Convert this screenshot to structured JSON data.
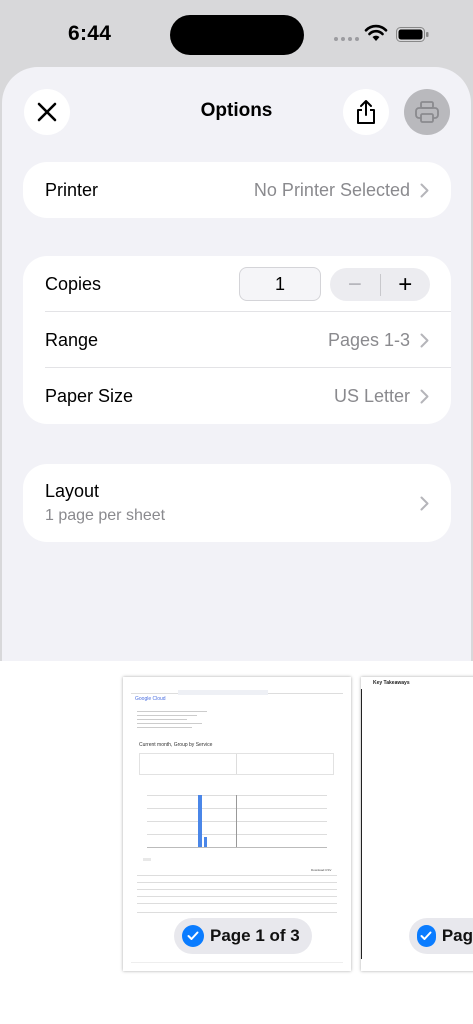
{
  "status_bar": {
    "time": "6:44"
  },
  "header": {
    "title": "Options"
  },
  "printer": {
    "label": "Printer",
    "value": "No Printer Selected"
  },
  "copies": {
    "label": "Copies",
    "value": "1",
    "minus": "−",
    "plus": "+"
  },
  "range": {
    "label": "Range",
    "value": "Pages 1-3"
  },
  "paper_size": {
    "label": "Paper Size",
    "value": "US Letter"
  },
  "layout": {
    "label": "Layout",
    "value": "1 page per sheet"
  },
  "preview": {
    "page1_badge": "Page 1 of 3",
    "page2_badge": "Pag",
    "page1": {
      "brand": "Google Cloud",
      "section_heading": "Current month, Group by Service",
      "download": "Download CSV"
    },
    "page2": {
      "heading": "Key Takeaways"
    }
  },
  "colors": {
    "accent": "#0a7cff",
    "sheet_bg": "#f2f2f7"
  }
}
